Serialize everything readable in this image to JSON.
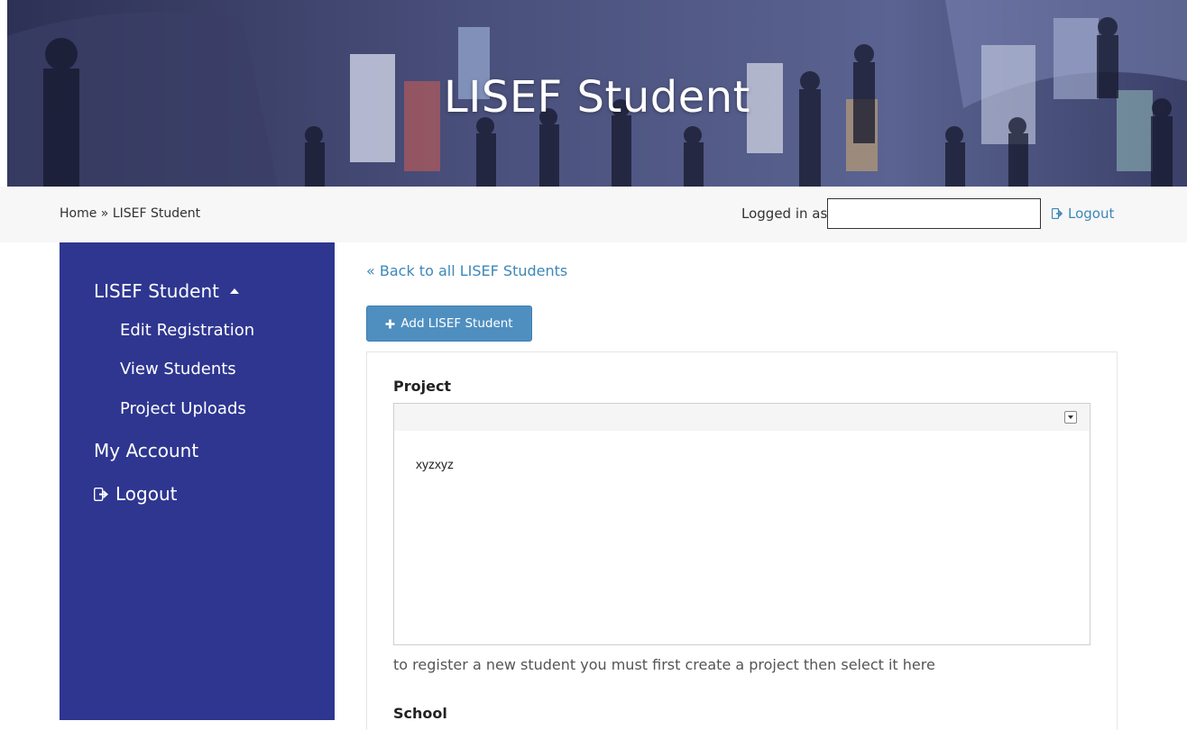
{
  "hero": {
    "title": "LISEF Student"
  },
  "breadcrumb": {
    "home": "Home",
    "separator": " » ",
    "current": "LISEF Student"
  },
  "header": {
    "logged_in_label": "Logged in as:",
    "logged_in_value": "",
    "logout_label": "Logout",
    "logout_icon": "sign-out-icon"
  },
  "sidebar": {
    "section": {
      "label": "LISEF Student",
      "icon": "caret-up-icon"
    },
    "sub_items": [
      {
        "label": "Edit Registration"
      },
      {
        "label": "View Students"
      },
      {
        "label": "Project Uploads"
      }
    ],
    "my_account": "My Account",
    "logout": {
      "label": "Logout",
      "icon": "sign-out-icon"
    }
  },
  "main": {
    "back_link": "« Back to all LISEF Students",
    "add_button": {
      "label": "Add LISEF Student",
      "icon": "plus-icon"
    },
    "project": {
      "label": "Project",
      "selected_value": "",
      "options": [
        "xyzxyz"
      ],
      "help_text": "to register a new student you must first create a project then select it here"
    },
    "school": {
      "label": "School"
    }
  },
  "colors": {
    "sidebar_bg": "#2e3690",
    "link": "#3d87b8",
    "button_bg": "#4f8fc0",
    "breadcrumb_bar_bg": "#f7f7f7"
  }
}
